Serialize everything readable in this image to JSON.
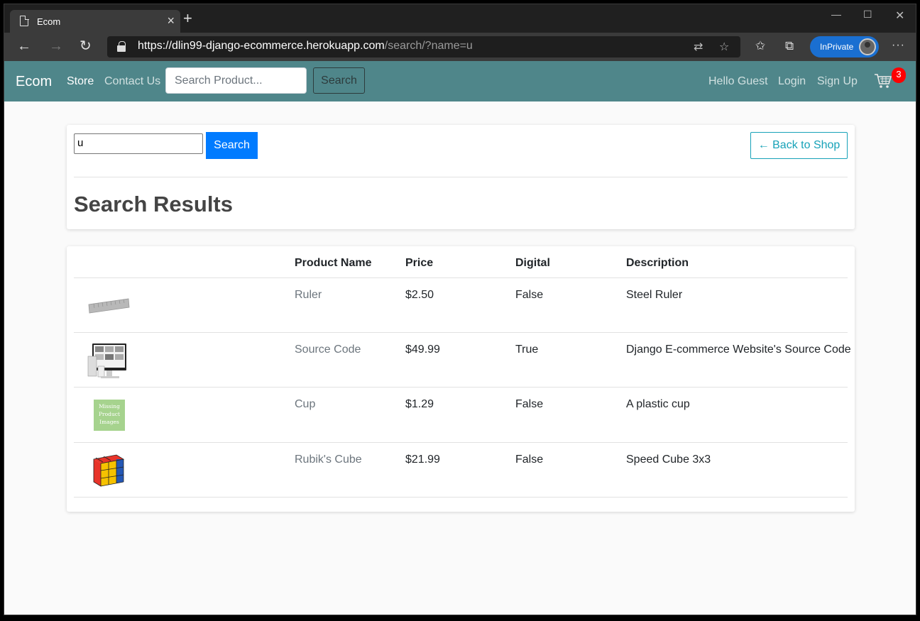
{
  "browser": {
    "tab_title": "Ecom",
    "url_host": "https://dlin99-django-ecommerce.herokuapp.com",
    "url_path": "/search/?name=u",
    "inprivate_label": "InPrivate"
  },
  "nav": {
    "brand": "Ecom",
    "store": "Store",
    "contact": "Contact Us",
    "search_placeholder": "Search Product...",
    "search_button": "Search",
    "greeting": "Hello Guest",
    "login": "Login",
    "signup": "Sign Up",
    "cart_count": "3"
  },
  "search": {
    "query": "u",
    "button": "Search",
    "back": "← Back to Shop",
    "title": "Search Results"
  },
  "table": {
    "headers": [
      "Product Name",
      "Price",
      "Digital",
      "Description"
    ],
    "rows": [
      {
        "name": "Ruler",
        "price": "$2.50",
        "digital": "False",
        "description": "Steel Ruler",
        "thumb": "ruler"
      },
      {
        "name": "Source Code",
        "price": "$49.99",
        "digital": "True",
        "description": "Django E-commerce Website's Source Code",
        "thumb": "monitor"
      },
      {
        "name": "Cup",
        "price": "$1.29",
        "digital": "False",
        "description": "A plastic cup",
        "thumb": "missing",
        "thumb_text": [
          "Missing",
          "Product",
          "Images"
        ]
      },
      {
        "name": "Rubik's Cube",
        "price": "$21.99",
        "digital": "False",
        "description": "Speed Cube 3x3",
        "thumb": "cube"
      }
    ]
  },
  "colors": {
    "nav_bg": "#4f868a",
    "primary": "#007bff",
    "info": "#17a2b8",
    "badge": "#ff0000"
  }
}
